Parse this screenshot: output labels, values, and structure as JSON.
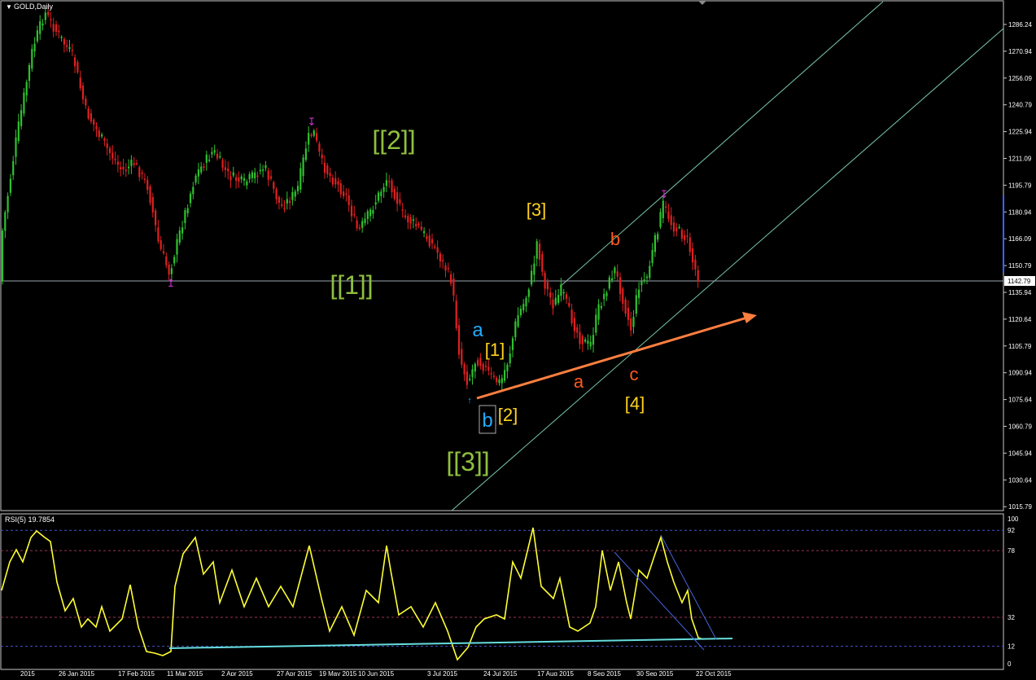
{
  "main_title": "GOLD,Daily",
  "rsi_title": "RSI(5) 19.7854",
  "current_price_label": "1142.79",
  "colors": {
    "background": "#000000",
    "bull_candle": "#2fc22f",
    "bear_candle": "#e02020",
    "channel": "#78c8a8",
    "trend_arrow": "#ff7f3f",
    "rsi_line": "#ffff33",
    "rsi_support": "#66dddd",
    "marker": "#cc33cc",
    "wave_green": "#8fbf3f",
    "wave_yellow": "#ffd21e",
    "wave_orange": "#ff5a1e",
    "wave_blue": "#22aaff"
  },
  "price_axis": [
    "1286.24",
    "1270.94",
    "1256.09",
    "1240.79",
    "1225.94",
    "1211.09",
    "1195.79",
    "1180.94",
    "1166.09",
    "1150.79",
    "1135.94",
    "1120.64",
    "1105.79",
    "1090.94",
    "1075.64",
    "1060.79",
    "1045.94",
    "1030.64",
    "1015.79"
  ],
  "rsi_axis": [
    "100",
    "92",
    "78",
    "32",
    "12",
    "0"
  ],
  "date_axis": [
    "2015",
    "26 Jan 2015",
    "17 Feb 2015",
    "11 Mar 2015",
    "2 Apr 2015",
    "27 Apr 2015",
    "19 May 2015",
    "10 Jun 2015",
    "3 Jul 2015",
    "24 Jul 2015",
    "17 Aug 2015",
    "8 Sep 2015",
    "30 Sep 2015",
    "22 Oct 2015"
  ],
  "wave_labels": {
    "w1_major": "[[1]]",
    "w2_major": "[[2]]",
    "w3_major": "[[3]]",
    "a_blue": "a",
    "b_blue": "b",
    "s1": "[1]",
    "s2": "[2]",
    "s3": "[3]",
    "s4": "[4]",
    "a_orange": "a",
    "b_orange": "b",
    "c_orange": "c"
  }
}
